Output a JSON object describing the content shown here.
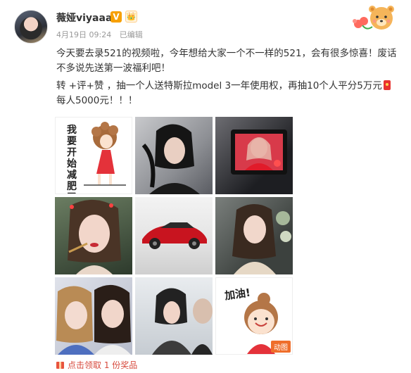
{
  "author": {
    "name": "薇娅viyaaa",
    "verified_badge": "V",
    "crown_badge": "👑"
  },
  "meta": {
    "date": "4月19日 09:24",
    "edited": "已编辑"
  },
  "post": {
    "line1": "今天要去录521的视频啦，今年想给大家一个不一样的521，会有很多惊喜！废话不多说先送第一波福利吧！",
    "line2": "转 +评+赞 ，抽一个人送特斯拉model 3一年使用权，再抽10个人平分5万元",
    "line3": "每人5000元！！！"
  },
  "images": {
    "tile1_text": "我要开始减肥了",
    "tile9_text": "加油!",
    "gif_badge": "动图"
  },
  "footer": {
    "reward": "点击领取 1 份奖品"
  },
  "colors": {
    "verified": "#f7a000",
    "link_red": "#d74a3d",
    "tesla_red": "#c8141f"
  }
}
